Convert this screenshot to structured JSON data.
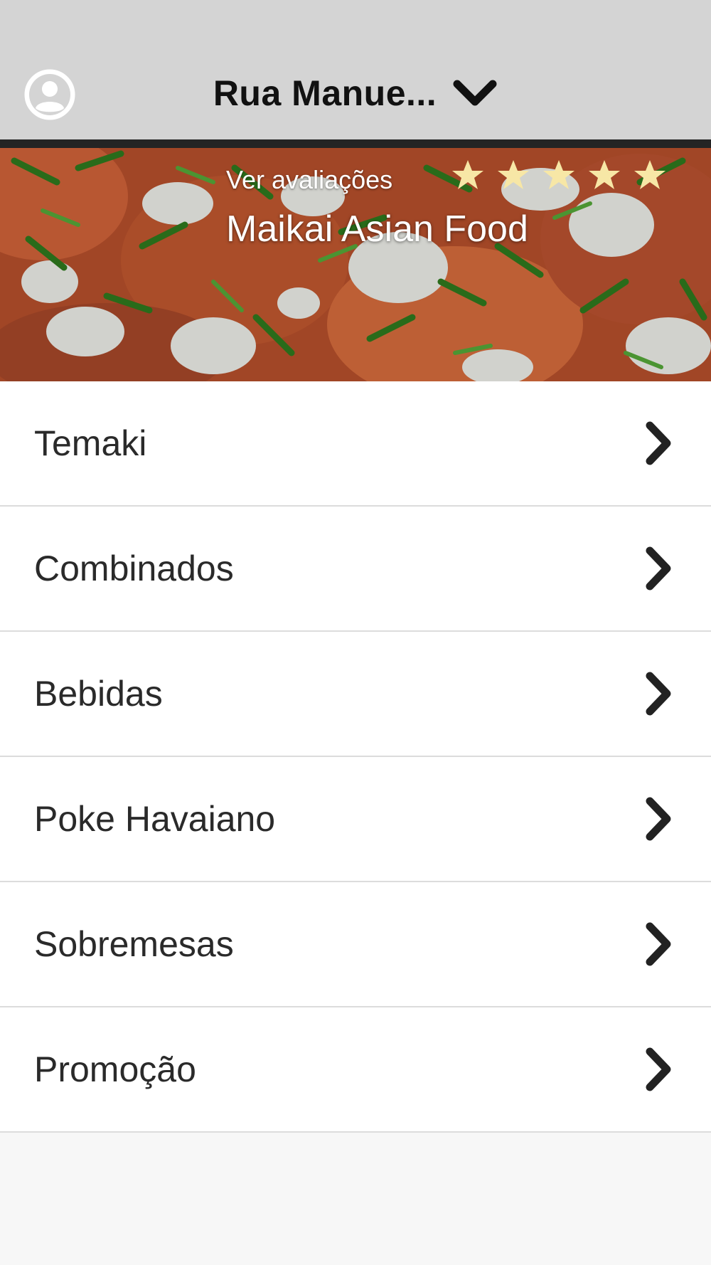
{
  "header": {
    "address": "Rua Manue...",
    "icons": {
      "profile": "user-circle-icon",
      "dropdown": "chevron-down-icon"
    }
  },
  "restaurant": {
    "reviews_link": "Ver avaliações",
    "name": "Maikai Asian Food",
    "rating": 5,
    "rating_max": 5,
    "star_color": "#f7e7a6"
  },
  "menu": {
    "items": [
      {
        "label": "Temaki"
      },
      {
        "label": "Combinados"
      },
      {
        "label": "Bebidas"
      },
      {
        "label": "Poke Havaiano"
      },
      {
        "label": "Sobremesas"
      },
      {
        "label": "Promoção"
      }
    ],
    "item_icon": "chevron-right-icon"
  },
  "colors": {
    "header_bg": "#d4d4d4",
    "page_bg": "#f7f7f7",
    "text": "#2a2a2a"
  }
}
